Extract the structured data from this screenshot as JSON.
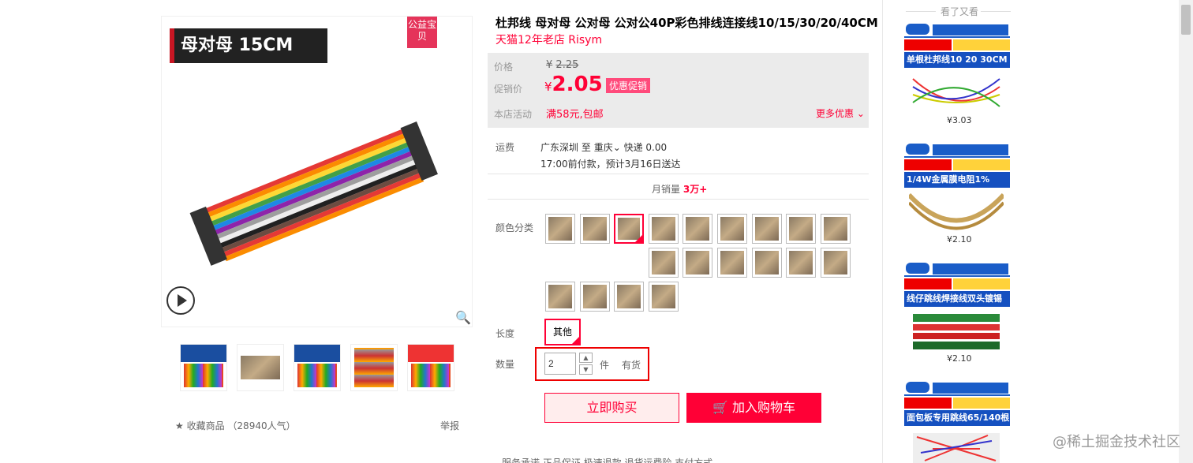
{
  "gallery": {
    "banner_text": "母对母 15CM",
    "badge_text": "公益宝贝",
    "favorite": "收藏商品",
    "popularity": "（28940人气）",
    "report": "举报"
  },
  "product": {
    "title": "杜邦线 母对母 公对母 公对公40P彩色排线连接线10/15/30/20/40CM",
    "shop": "天猫12年老店 Risym",
    "price_label": "价格",
    "original_price_currency": "¥",
    "original_price": "2.25",
    "promo_label": "促销价",
    "promo_currency": "¥",
    "promo_price": "2.05",
    "promo_tag": "优惠促销",
    "activity_label": "本店活动",
    "activity": "满58元,包邮",
    "more_discounts": "更多优惠",
    "shipping_label": "运费",
    "ship_from": "广东深圳",
    "ship_to_word": "至",
    "ship_to": "重庆",
    "ship_method": "快递 0.00",
    "ship_note": "17:00前付款，预计3月16日送达",
    "monthly_label": "月销量",
    "monthly_value": "3万+",
    "color_label": "颜色分类",
    "length_label": "长度",
    "length_option": "其他",
    "qty_label": "数量",
    "qty_value": "2",
    "qty_unit": "件",
    "stock": "有货",
    "buy_now": "立即购买",
    "add_cart": "加入购物车",
    "services": "服务承诺    正品保证    极速退款    退货运费险                                  支付方式"
  },
  "sidebar": {
    "heading": "看了又看",
    "items": [
      {
        "headline": "单根杜邦线10 20 30CM",
        "price": "¥3.03"
      },
      {
        "headline": "1/4W金属膜电阻1%",
        "price": "¥2.10"
      },
      {
        "headline": "线仔跳线焊接线双头镀锡",
        "price": "¥2.10"
      },
      {
        "headline": "面包板专用跳线65/140根",
        "price": ""
      }
    ]
  },
  "watermark": "@稀土掘金技术社区"
}
